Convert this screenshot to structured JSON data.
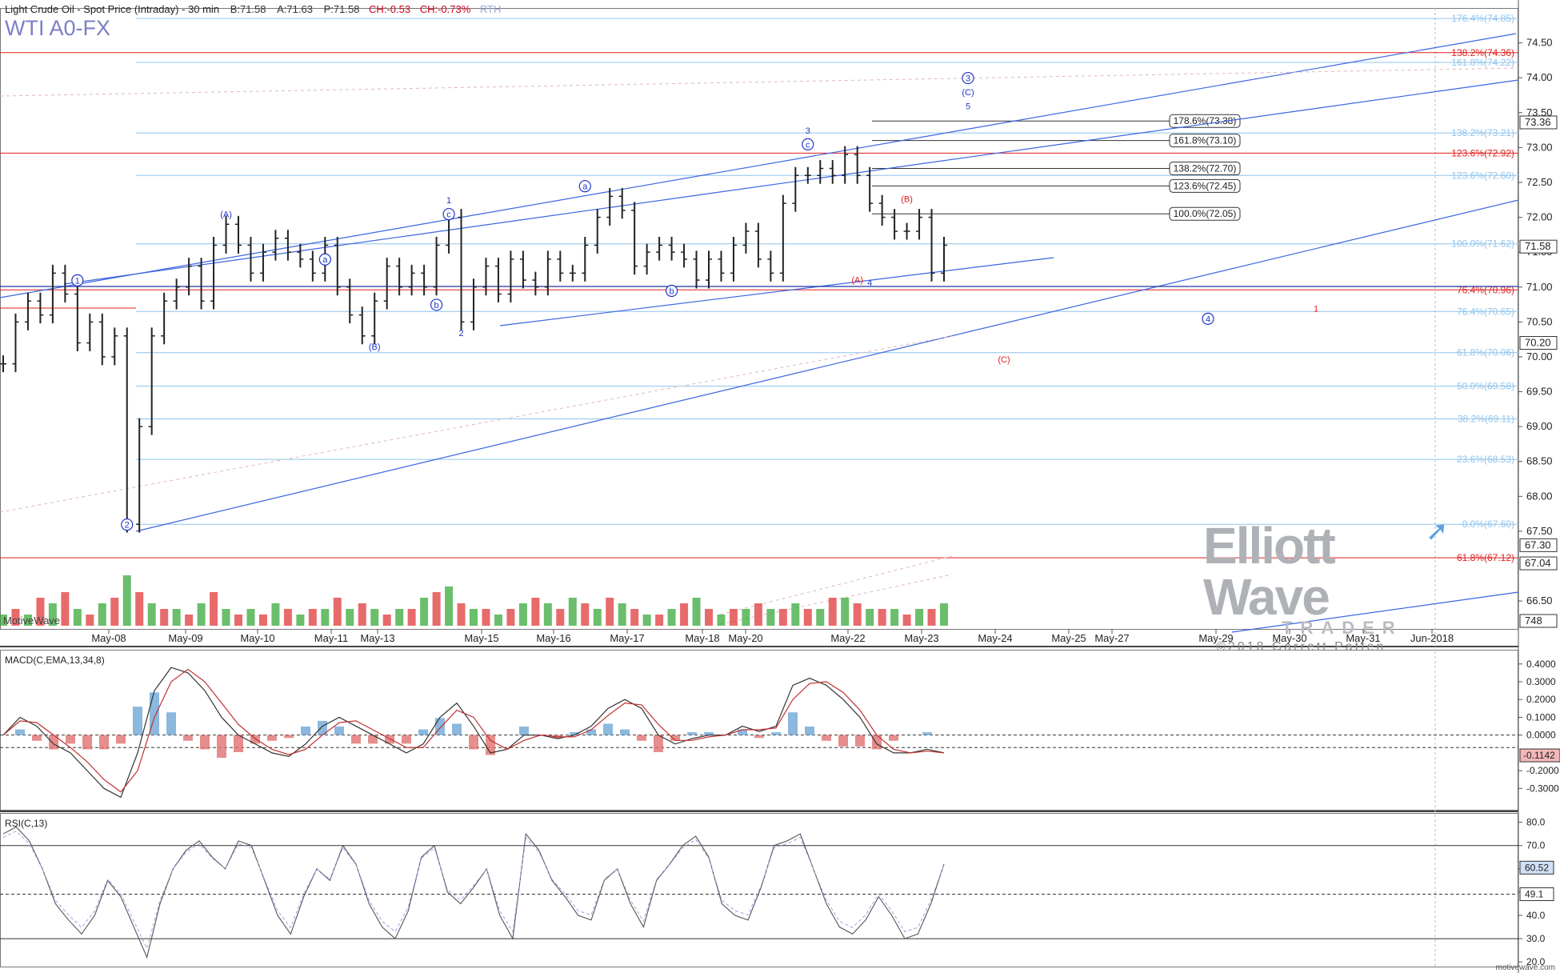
{
  "header": {
    "title": "Light Crude Oil - Spot Price (Intraday) - 30 min",
    "bid": "B:71.58",
    "ask": "A:71.63",
    "price": "P:71.58",
    "change": "CH:-0.53",
    "change_pct": "CH:-0.73%",
    "session": "RTH",
    "symbol": "WTI A0-FX"
  },
  "branding": {
    "platform": "MotiveWave",
    "logo_line1": "Elliott Wave",
    "logo_line2": "TRADER",
    "copyright": "©2018 Garrett Patten",
    "website": "motivewave.com"
  },
  "colors": {
    "fib_blue": "#8fc4ec",
    "fib_red": "#e01e1e",
    "trend": "#3a66e0",
    "up_bar": "#3aa83a",
    "down_bar": "#e03a3a",
    "price_bar": "#222222"
  },
  "chart_data": [
    {
      "type": "line",
      "name": "price",
      "x_labels": [
        "May-08",
        "May-09",
        "May-10",
        "May-11",
        "May-13",
        "May-15",
        "May-16",
        "May-17",
        "May-18",
        "May-20",
        "May-22",
        "May-23",
        "May-24",
        "May-25",
        "May-27",
        "May-29",
        "May-30",
        "May-31",
        "Jun-2018"
      ],
      "ylim": [
        66.1,
        75.0
      ],
      "y_ticks": [
        "74.50",
        "74.00",
        "73.50",
        "73.00",
        "72.50",
        "72.00",
        "71.50",
        "71.00",
        "70.50",
        "70.00",
        "69.50",
        "69.00",
        "68.50",
        "68.00",
        "67.50",
        "66.50"
      ],
      "series": [
        {
          "values": [
            69.9,
            70.5,
            70.8,
            70.6,
            71.2,
            70.9,
            70.2,
            70.5,
            70.0,
            70.3,
            67.6,
            69.0,
            70.3,
            70.8,
            71.0,
            71.3,
            70.8,
            71.6,
            71.9,
            71.6,
            71.2,
            71.5,
            71.7,
            71.5,
            71.4,
            71.2,
            71.6,
            71.0,
            70.6,
            70.3,
            70.8,
            71.3,
            71.0,
            71.2,
            71.0,
            71.6,
            72.0,
            70.5,
            71.0,
            71.3,
            70.9,
            71.4,
            71.1,
            71.0,
            71.4,
            71.2,
            71.2,
            71.6,
            72.0,
            72.3,
            72.1,
            71.3,
            71.5,
            71.6,
            71.5,
            71.4,
            71.1,
            71.4,
            71.2,
            71.6,
            71.8,
            71.4,
            71.2,
            72.2,
            72.6,
            72.6,
            72.7,
            72.6,
            72.9,
            72.6,
            72.2,
            72.0,
            71.8,
            71.8,
            72.0,
            71.2,
            71.6
          ]
        }
      ],
      "volume": [
        0.2,
        0.3,
        0.2,
        0.5,
        0.4,
        0.6,
        0.3,
        0.2,
        0.4,
        0.5,
        0.9,
        0.6,
        0.4,
        0.3,
        0.3,
        0.2,
        0.4,
        0.6,
        0.3,
        0.2,
        0.3,
        0.2,
        0.4,
        0.3,
        0.2,
        0.3,
        0.3,
        0.5,
        0.3,
        0.4,
        0.3,
        0.2,
        0.3,
        0.3,
        0.5,
        0.6,
        0.7,
        0.4,
        0.3,
        0.3,
        0.2,
        0.3,
        0.4,
        0.5,
        0.4,
        0.3,
        0.5,
        0.4,
        0.3,
        0.5,
        0.4,
        0.3,
        0.2,
        0.2,
        0.3,
        0.4,
        0.5,
        0.3,
        0.2,
        0.3,
        0.3,
        0.4,
        0.3,
        0.3,
        0.4,
        0.3,
        0.3,
        0.5,
        0.5,
        0.4,
        0.3,
        0.3,
        0.3,
        0.2,
        0.3,
        0.3,
        0.4
      ],
      "fib_levels_blue": [
        {
          "label": "176.4%(74.85)",
          "y": 74.85
        },
        {
          "label": "161.8%(74.22)",
          "y": 74.22
        },
        {
          "label": "138.2%(73.21)",
          "y": 73.21
        },
        {
          "label": "123.6%(72.60)",
          "y": 72.6
        },
        {
          "label": "100.0%(71.62)",
          "y": 71.62
        },
        {
          "label": "76.4%(70.65)",
          "y": 70.65
        },
        {
          "label": "61.8%(70.06)",
          "y": 70.06
        },
        {
          "label": "50.0%(69.58)",
          "y": 69.58
        },
        {
          "label": "38.2%(69.11)",
          "y": 69.11
        },
        {
          "label": "23.6%(68.53)",
          "y": 68.53
        },
        {
          "label": "0.0%(67.60)",
          "y": 67.6
        }
      ],
      "fib_levels_red": [
        {
          "label": "138.2%(74.36)",
          "y": 74.36
        },
        {
          "label": "123.6%(72.92)",
          "y": 72.92
        },
        {
          "label": "76.4%(70.96)",
          "y": 70.96
        },
        {
          "label": "61.8%(67.12)",
          "y": 67.12
        }
      ],
      "ext_levels": [
        {
          "label": "178.6%(73.38)",
          "y": 73.38
        },
        {
          "label": "161.8%(73.10)",
          "y": 73.1
        },
        {
          "label": "138.2%(72.70)",
          "y": 72.7
        },
        {
          "label": "123.6%(72.45)",
          "y": 72.45
        },
        {
          "label": "100.0%(72.05)",
          "y": 72.05
        }
      ],
      "price_tags": [
        {
          "label": "73.36",
          "y": 73.36
        },
        {
          "label": "71.58",
          "y": 71.58
        },
        {
          "label": "70.20",
          "y": 70.2
        },
        {
          "label": "67.30",
          "y": 67.3
        },
        {
          "label": "67.04",
          "y": 67.04
        },
        {
          "label": "748",
          "y": 66.16
        }
      ],
      "wave_labels": [
        {
          "text": "1",
          "circle": true,
          "color": "blue",
          "bar": 6,
          "y": 71.05
        },
        {
          "text": "2",
          "circle": true,
          "color": "blue",
          "bar": 10,
          "y": 67.55
        },
        {
          "text": "(A)",
          "circle": false,
          "color": "blue",
          "bar": 18,
          "y": 72.0
        },
        {
          "text": "a",
          "circle": true,
          "color": "blue",
          "bar": 26,
          "y": 71.35
        },
        {
          "text": "(B)",
          "circle": false,
          "color": "blue",
          "bar": 30,
          "y": 70.1
        },
        {
          "text": "b",
          "circle": true,
          "color": "blue",
          "bar": 35,
          "y": 70.7
        },
        {
          "text": "1",
          "circle": false,
          "color": "blue",
          "bar": 36,
          "y": 72.2
        },
        {
          "text": "c",
          "circle": true,
          "color": "blue",
          "bar": 36,
          "y": 72.0
        },
        {
          "text": "2",
          "circle": false,
          "color": "blue",
          "bar": 37,
          "y": 70.3
        },
        {
          "text": "a",
          "circle": true,
          "color": "blue",
          "bar": 47,
          "y": 72.4
        },
        {
          "text": "b",
          "circle": true,
          "color": "blue",
          "bar": 54,
          "y": 70.9
        },
        {
          "text": "3",
          "circle": false,
          "color": "blue",
          "bar": 65,
          "y": 73.2
        },
        {
          "text": "c",
          "circle": true,
          "color": "blue",
          "bar": 65,
          "y": 73.0
        },
        {
          "text": "(B)",
          "circle": false,
          "color": "red",
          "bar": 73,
          "y": 72.22
        },
        {
          "text": "(A)",
          "circle": false,
          "color": "red",
          "bar": 69,
          "y": 71.06
        },
        {
          "text": "4",
          "circle": false,
          "color": "blue",
          "bar": 70,
          "y": 71.02
        },
        {
          "text": "3",
          "circle": true,
          "color": "blue",
          "bar": 78,
          "y": 73.95
        },
        {
          "text": "(C)",
          "circle": false,
          "color": "blue",
          "bar": 78,
          "y": 73.75
        },
        {
          "text": "5",
          "circle": false,
          "color": "blue",
          "bar": 78,
          "y": 73.55
        },
        {
          "text": "4",
          "circle": true,
          "color": "blue",
          "bar": 98,
          "y": 70.5
        },
        {
          "text": "(C)",
          "circle": false,
          "color": "red",
          "bar": 81,
          "y": 69.92
        },
        {
          "text": "1",
          "circle": false,
          "color": "red",
          "bar": 107,
          "y": 70.65
        }
      ]
    },
    {
      "type": "line",
      "name": "MACD(C,EMA,13,34,8)",
      "ylim": [
        -0.42,
        0.48
      ],
      "y_ticks": [
        "0.4000",
        "0.3000",
        "0.2000",
        "0.1000",
        "0.0000",
        "-0.2000",
        "-0.3000"
      ],
      "value_tag": "-0.1142",
      "series": [
        {
          "values": [
            0.0,
            0.1,
            0.05,
            -0.05,
            -0.1,
            -0.2,
            -0.3,
            -0.35,
            -0.1,
            0.25,
            0.38,
            0.35,
            0.25,
            0.1,
            0.0,
            -0.05,
            -0.1,
            -0.12,
            -0.05,
            0.05,
            0.1,
            0.05,
            0.0,
            -0.05,
            -0.1,
            -0.05,
            0.1,
            0.18,
            0.05,
            -0.1,
            -0.08,
            0.0,
            0.0,
            -0.02,
            0.0,
            0.05,
            0.15,
            0.2,
            0.15,
            0.0,
            -0.05,
            -0.02,
            0.0,
            0.0,
            0.05,
            0.02,
            0.05,
            0.28,
            0.32,
            0.28,
            0.2,
            0.1,
            -0.05,
            -0.1,
            -0.1,
            -0.08,
            -0.1
          ]
        },
        {
          "values": [
            0.0,
            0.08,
            0.07,
            0.0,
            -0.07,
            -0.15,
            -0.25,
            -0.32,
            -0.2,
            0.1,
            0.3,
            0.37,
            0.3,
            0.18,
            0.06,
            -0.02,
            -0.08,
            -0.11,
            -0.08,
            0.0,
            0.07,
            0.08,
            0.03,
            -0.02,
            -0.07,
            -0.07,
            0.04,
            0.14,
            0.1,
            -0.03,
            -0.08,
            -0.03,
            0.0,
            -0.01,
            -0.01,
            0.03,
            0.11,
            0.18,
            0.17,
            0.06,
            -0.03,
            -0.03,
            -0.01,
            0.0,
            0.03,
            0.03,
            0.04,
            0.2,
            0.29,
            0.3,
            0.24,
            0.14,
            0.0,
            -0.08,
            -0.1,
            -0.09,
            -0.1
          ]
        }
      ]
    },
    {
      "type": "line",
      "name": "RSI(C,13)",
      "ylim": [
        18,
        84
      ],
      "y_ticks": [
        "80.0",
        "70.0",
        "60.0",
        "50.0",
        "40.0",
        "30.0",
        "20.0"
      ],
      "levels": [
        70,
        49.1,
        30
      ],
      "value_tags": [
        "60.52",
        "49.1"
      ],
      "series": [
        {
          "values": [
            75,
            78,
            72,
            60,
            45,
            38,
            32,
            40,
            55,
            48,
            35,
            22,
            45,
            60,
            68,
            72,
            65,
            60,
            72,
            70,
            55,
            40,
            32,
            48,
            60,
            55,
            70,
            62,
            45,
            35,
            30,
            42,
            65,
            70,
            50,
            45,
            52,
            60,
            40,
            30,
            75,
            68,
            55,
            48,
            40,
            38,
            55,
            60,
            45,
            35,
            55,
            62,
            70,
            74,
            65,
            45,
            40,
            38,
            52,
            70,
            72,
            75,
            60,
            45,
            35,
            32,
            38,
            48,
            40,
            30,
            32,
            45,
            62
          ]
        }
      ]
    }
  ]
}
